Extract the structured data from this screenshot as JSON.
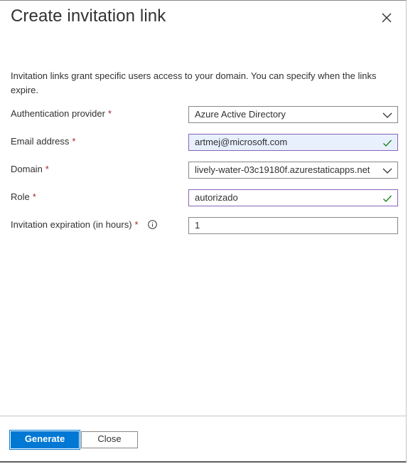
{
  "dialog": {
    "title": "Create invitation link",
    "description": "Invitation links grant specific users access to your domain. You can specify when the links expire."
  },
  "form": {
    "auth_provider": {
      "label": "Authentication provider",
      "required_mark": "*",
      "value": "Azure Active Directory"
    },
    "email": {
      "label": "Email address",
      "required_mark": "*",
      "value": "artmej@microsoft.com"
    },
    "domain": {
      "label": "Domain",
      "required_mark": "*",
      "value": "lively-water-03c19180f.azurestaticapps.net"
    },
    "role": {
      "label": "Role",
      "required_mark": "*",
      "value": "autorizado"
    },
    "expiration": {
      "label": "Invitation expiration (in hours)",
      "required_mark": "*",
      "value": "1"
    }
  },
  "footer": {
    "generate_label": "Generate",
    "close_label": "Close"
  },
  "colors": {
    "primary": "#0078d4",
    "required": "#a4262c",
    "valid_check": "#107c10",
    "valid_border": "#8764b8",
    "autofill_bg": "#e8f0fe"
  },
  "icons": {
    "close": "close-icon",
    "chevron": "chevron-down-icon",
    "check": "checkmark-icon",
    "info": "info-icon"
  }
}
